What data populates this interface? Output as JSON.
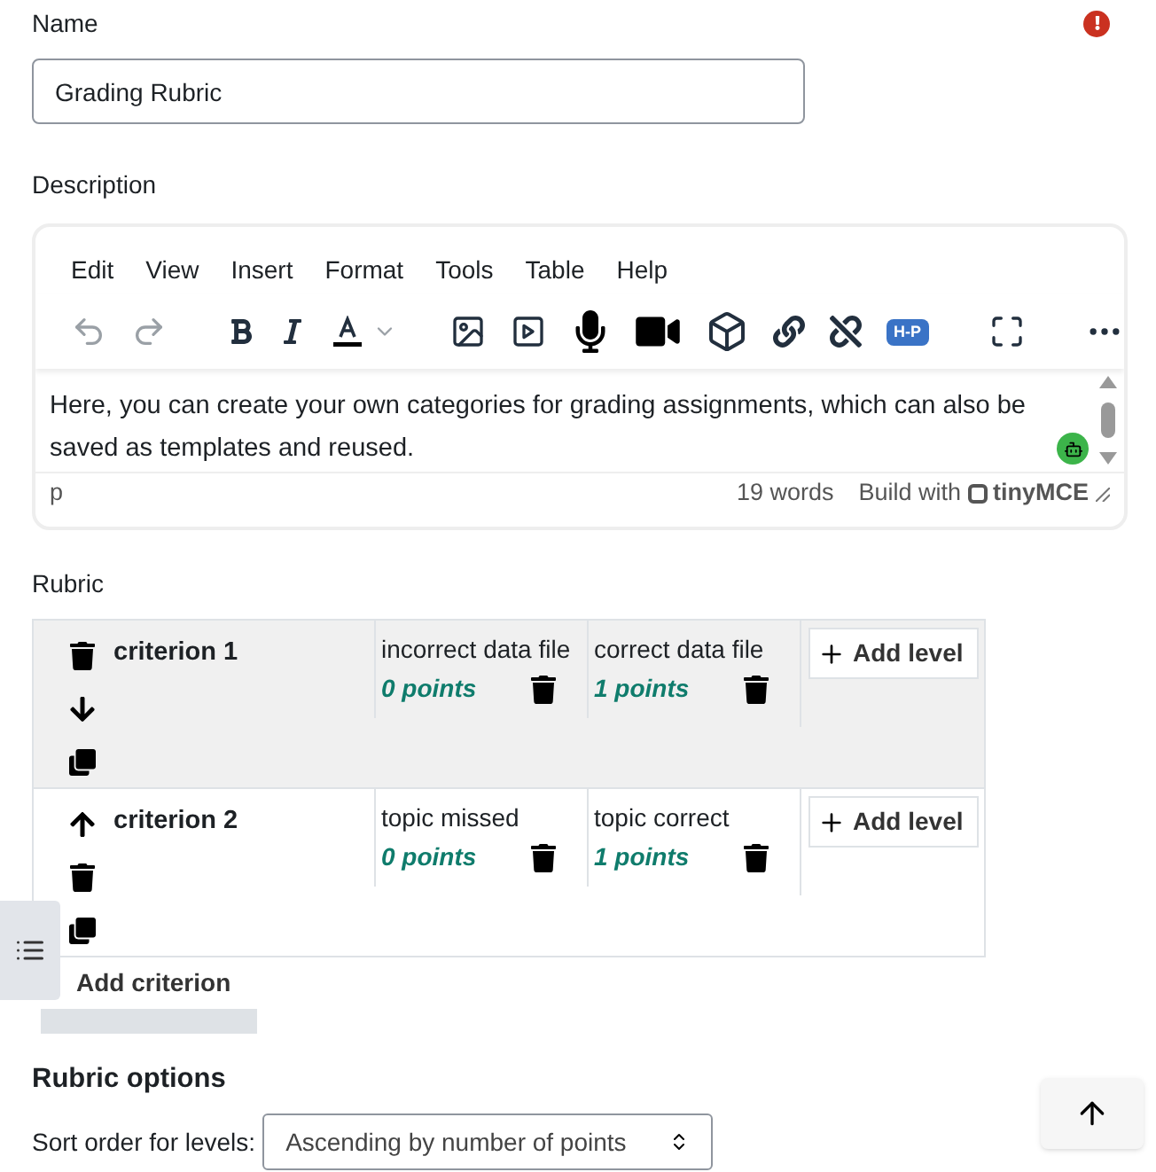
{
  "name_field": {
    "label": "Name",
    "required": true,
    "value": "Grading Rubric"
  },
  "description": {
    "label": "Description",
    "menu": [
      "Edit",
      "View",
      "Insert",
      "Format",
      "Tools",
      "Table",
      "Help"
    ],
    "toolbar": [
      {
        "kind": "undo",
        "disabled": true
      },
      {
        "kind": "redo",
        "disabled": true
      },
      {
        "kind": "bold",
        "disabled": false
      },
      {
        "kind": "italic",
        "disabled": false
      },
      {
        "kind": "textcolor",
        "disabled": false
      },
      {
        "kind": "image",
        "disabled": false
      },
      {
        "kind": "media",
        "disabled": false
      },
      {
        "kind": "mic",
        "disabled": false
      },
      {
        "kind": "video",
        "disabled": false
      },
      {
        "kind": "cube",
        "disabled": false
      },
      {
        "kind": "link",
        "disabled": false
      },
      {
        "kind": "unlink",
        "disabled": false
      },
      {
        "kind": "hp",
        "disabled": false,
        "label": "H-P"
      },
      {
        "kind": "fullscreen",
        "disabled": false
      },
      {
        "kind": "more",
        "disabled": false
      }
    ],
    "text": "Here, you can create your own categories for grading assignments, which can also be saved as templates and reused.",
    "path": "p",
    "word_count": "19 words",
    "branding": "Build with",
    "brand": "tinyMCE"
  },
  "rubric": {
    "label": "Rubric",
    "criteria": [
      {
        "name": "criterion 1",
        "selected": true,
        "actions": [
          {
            "kind": "delete"
          },
          {
            "kind": "down"
          },
          {
            "kind": "duplicate"
          }
        ],
        "levels": [
          {
            "definition": "incorrect data file",
            "score": "0 points"
          },
          {
            "definition": "correct data file",
            "score": "1 points"
          }
        ],
        "add_level": "Add level"
      },
      {
        "name": "criterion 2",
        "selected": false,
        "actions": [
          {
            "kind": "up"
          },
          {
            "kind": "delete"
          },
          {
            "kind": "duplicate"
          }
        ],
        "levels": [
          {
            "definition": "topic missed",
            "score": "0 points"
          },
          {
            "definition": "topic correct",
            "score": "1 points"
          }
        ],
        "add_level": "Add level"
      }
    ],
    "add_criterion": "Add criterion"
  },
  "options": {
    "title": "Rubric options",
    "sort_label": "Sort order for levels:",
    "sort_value": "Ascending by number of points"
  }
}
